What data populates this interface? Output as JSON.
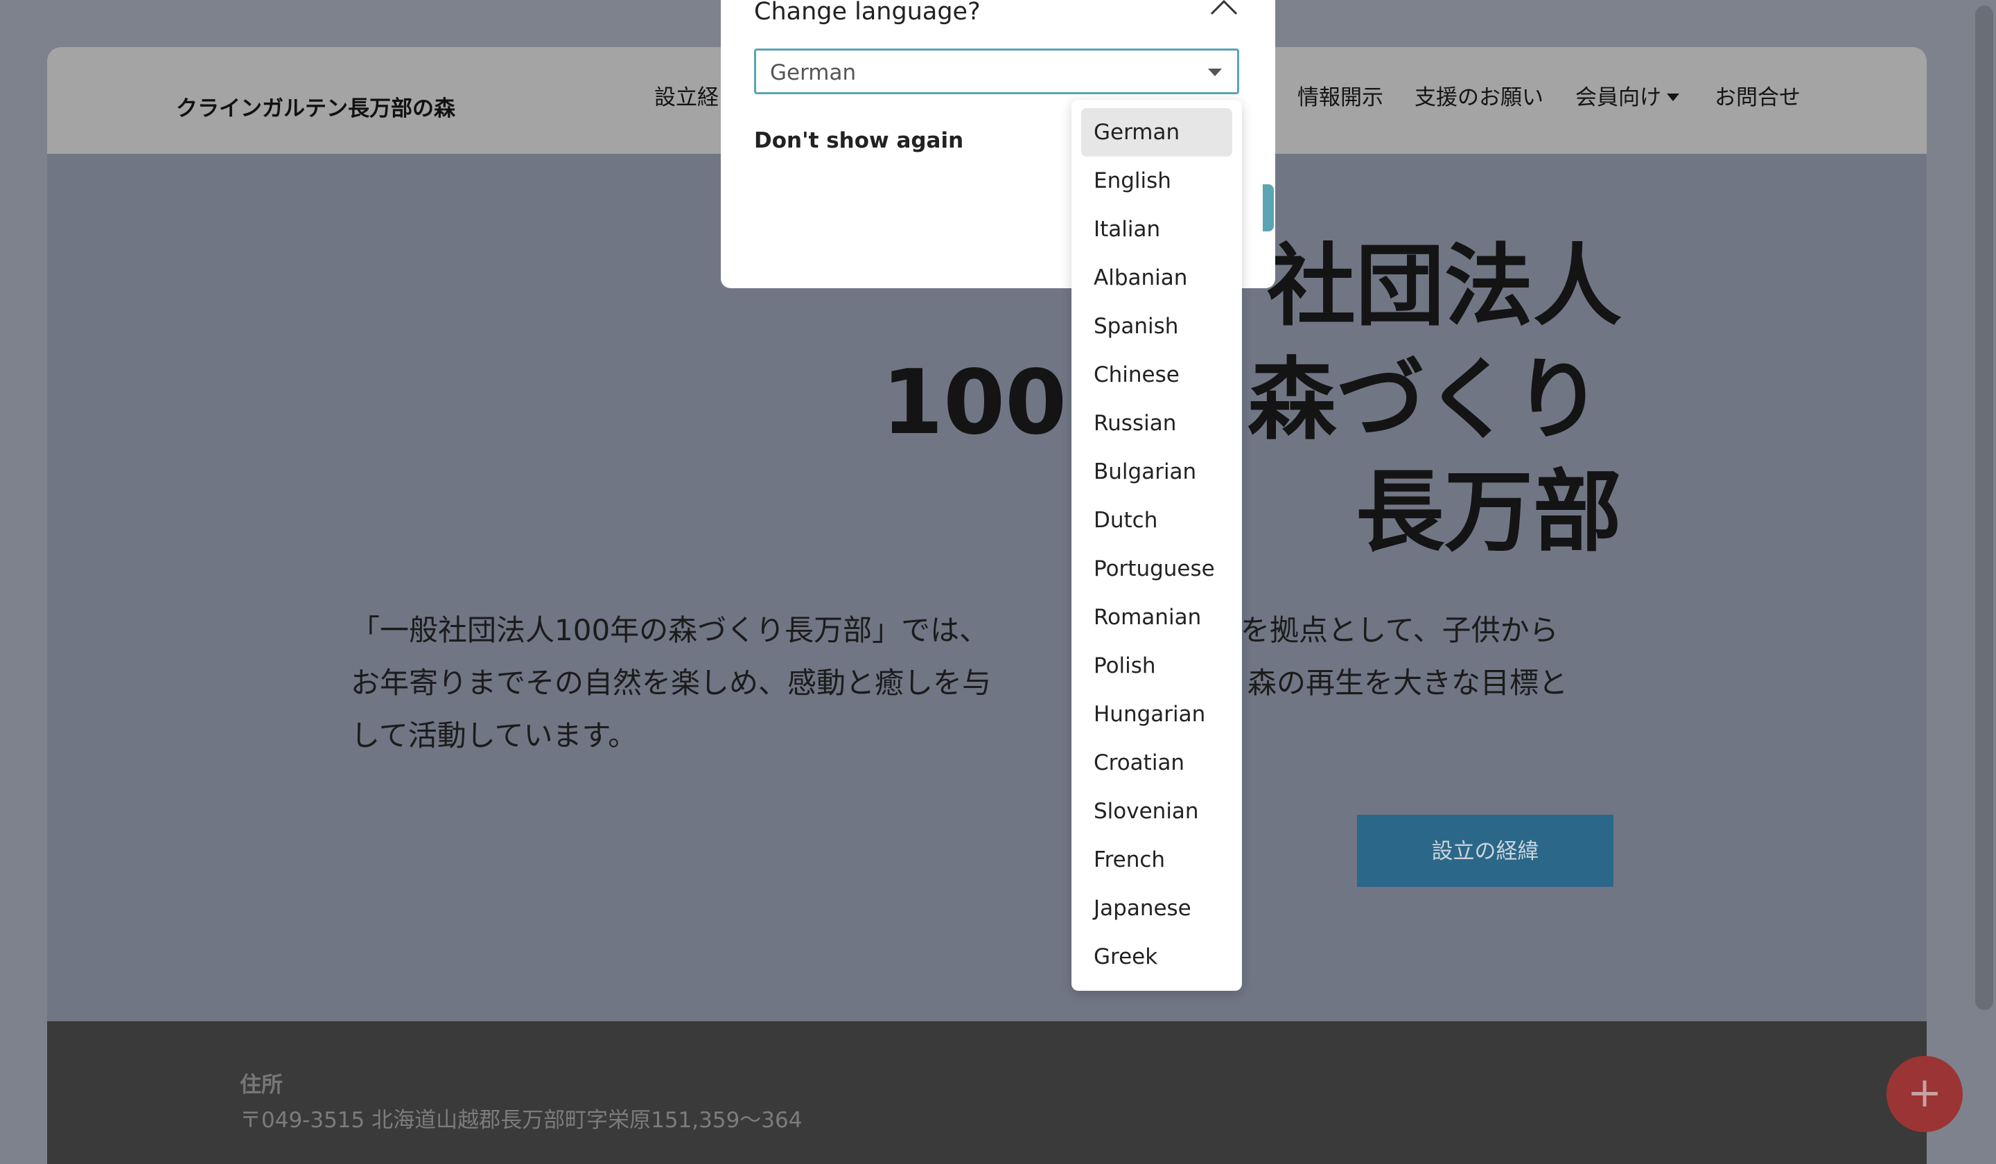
{
  "header": {
    "brand": "クラインガルテン長万部の森",
    "nav": [
      "設立経",
      "情報開示",
      "支援のお願い",
      "会員向け",
      "お問合せ"
    ]
  },
  "hero": {
    "title_lines": [
      "社団法人",
      "100",
      "森づくり",
      "長万部"
    ],
    "text_lines": [
      "「一般社団法人100年の森づくり長万部」では、",
      "を拠点として、子供から",
      "お年寄りまでその自然を楽しめ、感動と癒しを与",
      "森の再生を大きな目標と",
      "して活動しています。"
    ],
    "button": "設立の経緯"
  },
  "footer": {
    "label": "住所",
    "address": "〒049-3515 北海道山越郡長万部町字栄原151,359〜364"
  },
  "modal": {
    "title": "Change language?",
    "selected_value": "German",
    "dont_show": "Don't show again",
    "options": [
      "German",
      "English",
      "Italian",
      "Albanian",
      "Spanish",
      "Chinese",
      "Russian",
      "Bulgarian",
      "Dutch",
      "Portuguese",
      "Romanian",
      "Polish",
      "Hungarian",
      "Croatian",
      "Slovenian",
      "French",
      "Japanese",
      "Greek"
    ]
  },
  "fab": {
    "icon": "plus-icon",
    "label": "+"
  },
  "colors": {
    "accent": "#5aa4b4",
    "button": "#2b6788",
    "fab": "#9b3434",
    "footer": "#3a3a3a"
  }
}
